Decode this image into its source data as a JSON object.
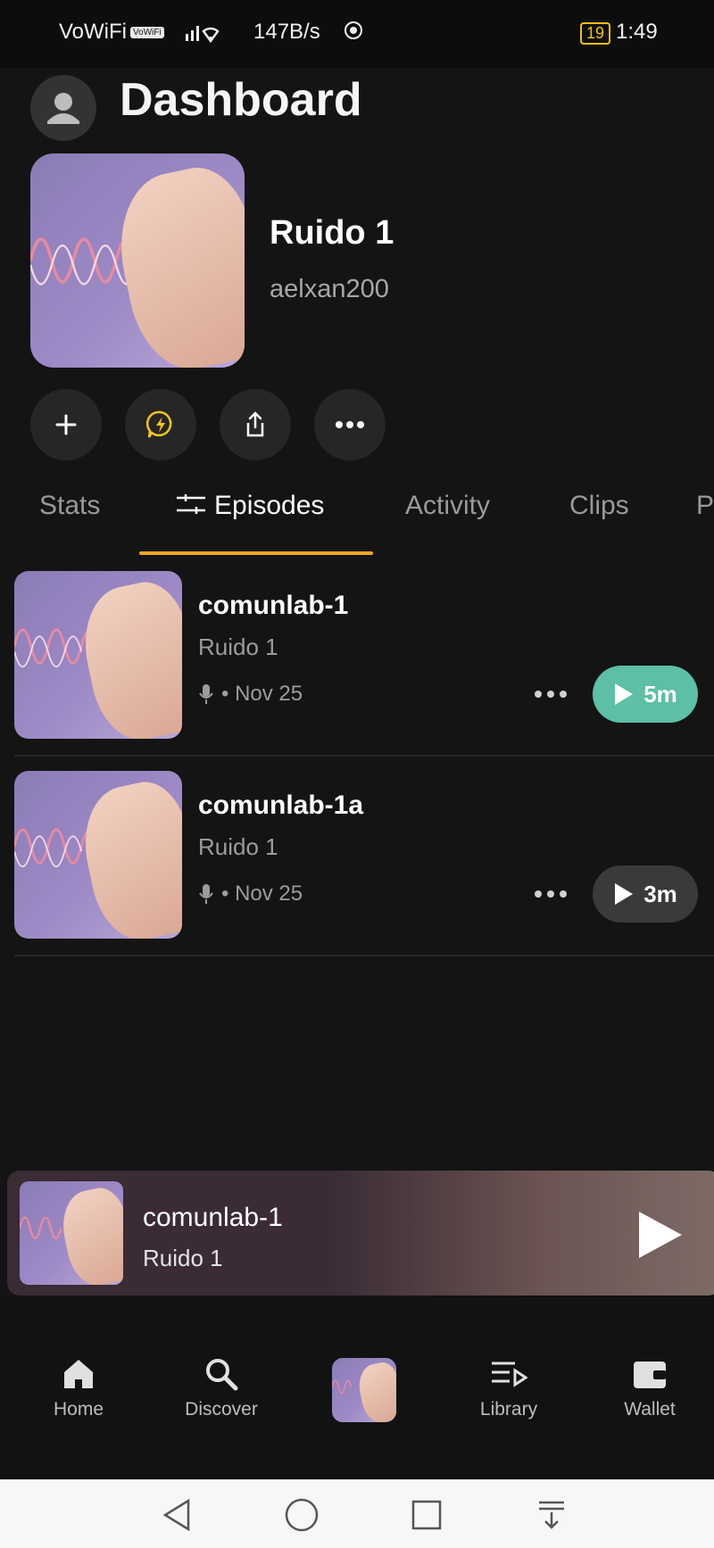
{
  "status_bar": {
    "carrier": "VoWiFi",
    "wifi_badge": "VoWiFi",
    "speed": "147B/s",
    "battery": "19",
    "time": "1:49"
  },
  "header": {
    "title": "Dashboard"
  },
  "show": {
    "title": "Ruido 1",
    "author": "aelxan200"
  },
  "tabs": [
    {
      "label": "Stats"
    },
    {
      "label": "Episodes"
    },
    {
      "label": "Activity"
    },
    {
      "label": "Clips"
    },
    {
      "label": "P"
    }
  ],
  "episodes": [
    {
      "title": "comunlab-1",
      "show": "Ruido 1",
      "meta": "• Nov 25",
      "duration": "5m",
      "play_color": "#5cbfa6"
    },
    {
      "title": "comunlab-1a",
      "show": "Ruido 1",
      "meta": "• Nov 25",
      "duration": "3m",
      "play_color": "#3a3a3a"
    }
  ],
  "now_playing": {
    "title": "comunlab-1",
    "show": "Ruido 1"
  },
  "nav": [
    {
      "label": "Home",
      "icon": "home-icon"
    },
    {
      "label": "Discover",
      "icon": "search-icon"
    },
    {
      "label": "",
      "icon": "now-playing-cover"
    },
    {
      "label": "Library",
      "icon": "library-icon"
    },
    {
      "label": "Wallet",
      "icon": "wallet-icon"
    }
  ],
  "colors": {
    "accent": "#f5a623",
    "play_active": "#5cbfa6",
    "background": "#141414"
  }
}
